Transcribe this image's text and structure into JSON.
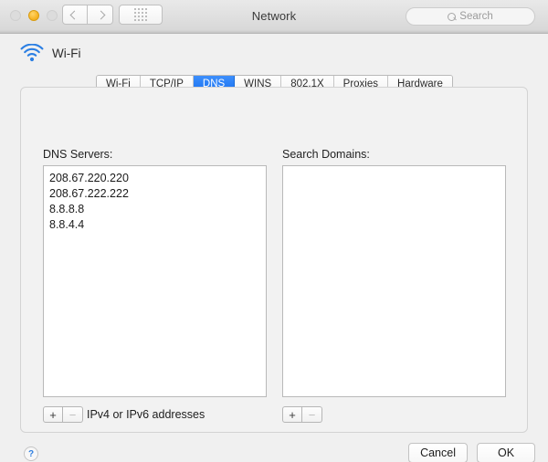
{
  "window": {
    "title": "Network",
    "traffic_lights": [
      {
        "name": "close",
        "state": "disabled",
        "color": "#dcdcdc"
      },
      {
        "name": "minimize",
        "state": "enabled",
        "color": "#f7b527"
      },
      {
        "name": "zoom",
        "state": "disabled",
        "color": "#dcdcdc"
      }
    ]
  },
  "toolbar": {
    "back_icon": "chevron-left-icon",
    "forward_icon": "chevron-right-icon",
    "show_all_icon": "grid-icon",
    "search": {
      "icon": "search-icon",
      "placeholder": "Search",
      "value": ""
    }
  },
  "service": {
    "icon": "wifi-icon",
    "name": "Wi-Fi",
    "accent_color": "#2b7fe3"
  },
  "tabs": {
    "selected": "DNS",
    "selected_color": "#1a72f0",
    "items": [
      {
        "label": "Wi-Fi",
        "selected": false
      },
      {
        "label": "TCP/IP",
        "selected": false
      },
      {
        "label": "DNS",
        "selected": true
      },
      {
        "label": "WINS",
        "selected": false
      },
      {
        "label": "802.1X",
        "selected": false
      },
      {
        "label": "Proxies",
        "selected": false
      },
      {
        "label": "Hardware",
        "selected": false
      }
    ]
  },
  "dns_servers": {
    "label": "DNS Servers:",
    "entries": [
      "208.67.220.220",
      "208.67.222.222",
      "8.8.8.8",
      "8.8.4.4"
    ],
    "add_label": "+",
    "remove_label": "−",
    "add_enabled": true,
    "remove_enabled": false,
    "hint": "IPv4 or IPv6 addresses"
  },
  "search_domains": {
    "label": "Search Domains:",
    "entries": [],
    "add_label": "+",
    "remove_label": "−",
    "add_enabled": true,
    "remove_enabled": false
  },
  "footer": {
    "help_label": "?",
    "cancel_label": "Cancel",
    "ok_label": "OK"
  }
}
